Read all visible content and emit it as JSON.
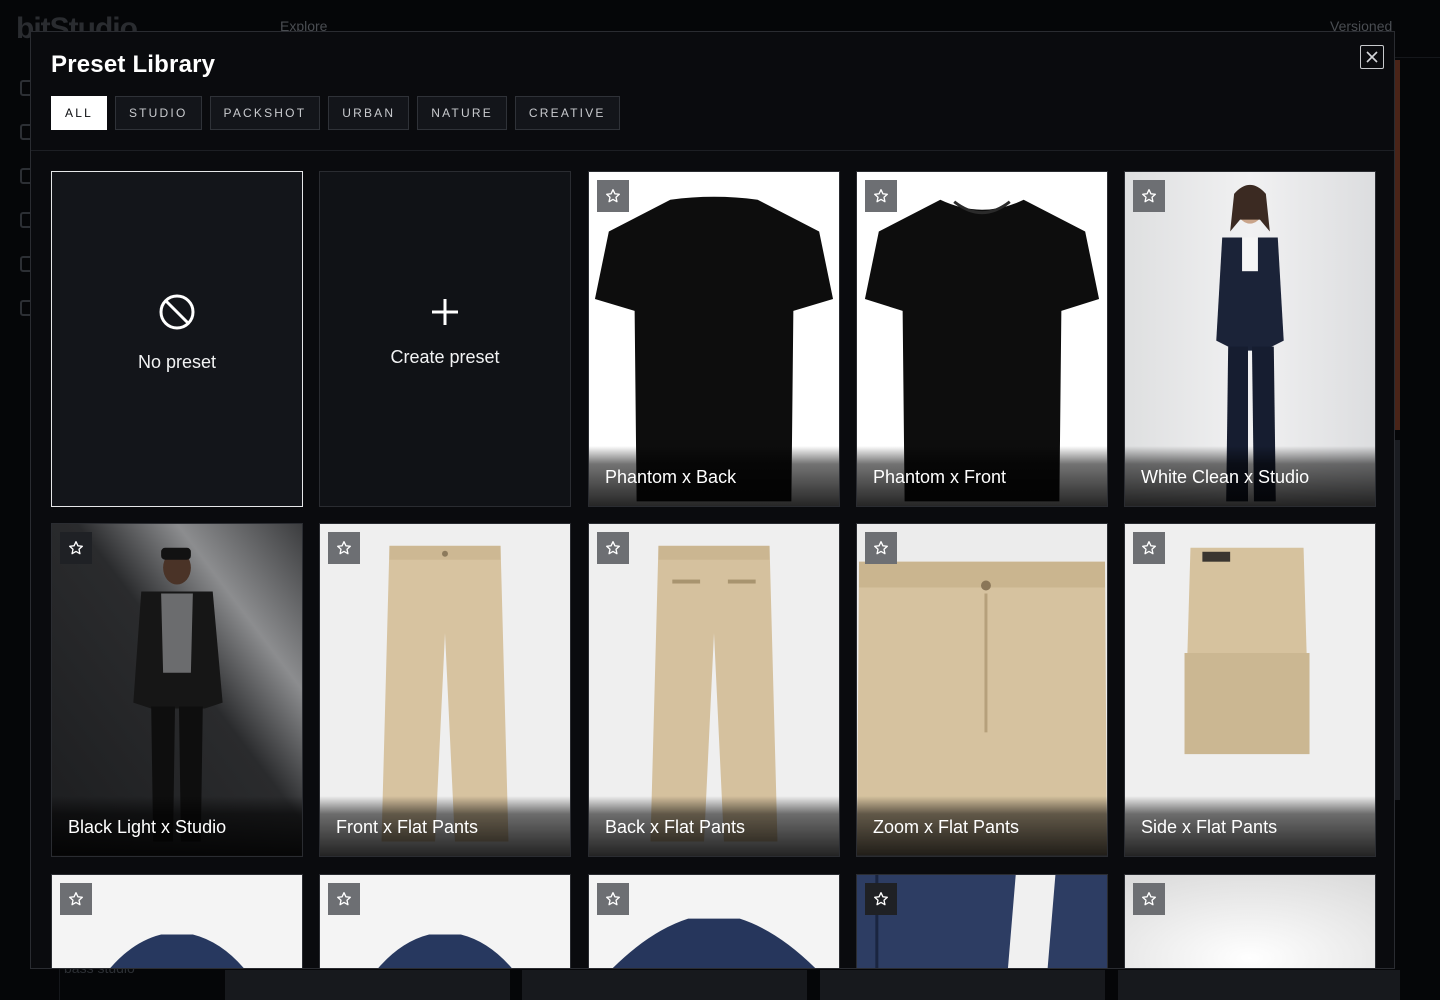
{
  "background": {
    "logo": "bitStudio",
    "topbar_items": [
      "Explore",
      "Versioned"
    ],
    "bottom_text": "bass studio"
  },
  "modal": {
    "title": "Preset Library",
    "close_icon": "close-icon",
    "filters": [
      {
        "label": "ALL",
        "active": true
      },
      {
        "label": "STUDIO",
        "active": false
      },
      {
        "label": "PACKSHOT",
        "active": false
      },
      {
        "label": "URBAN",
        "active": false
      },
      {
        "label": "NATURE",
        "active": false
      },
      {
        "label": "CREATIVE",
        "active": false
      }
    ],
    "no_preset": {
      "label": "No preset",
      "icon": "ban-icon",
      "selected": true
    },
    "create_preset": {
      "label": "Create preset",
      "icon": "plus-icon"
    },
    "presets": [
      {
        "label": "Phantom x Back",
        "image": "black-tshirt-back",
        "favorite": false
      },
      {
        "label": "Phantom x Front",
        "image": "black-tshirt-front",
        "favorite": false
      },
      {
        "label": "White Clean x Studio",
        "image": "woman-navy-suit",
        "favorite": false
      },
      {
        "label": "Black Light x Studio",
        "image": "man-leather-jacket",
        "favorite": false
      },
      {
        "label": "Front x Flat Pants",
        "image": "khaki-pants-front",
        "favorite": false
      },
      {
        "label": "Back x Flat Pants",
        "image": "khaki-pants-back",
        "favorite": false
      },
      {
        "label": "Zoom x Flat Pants",
        "image": "khaki-pants-zoom",
        "favorite": false
      },
      {
        "label": "Side x Flat Pants",
        "image": "khaki-pants-folded",
        "favorite": false
      },
      {
        "label": "",
        "image": "navy-jacket-collar",
        "favorite": false
      },
      {
        "label": "",
        "image": "navy-jacket-collar",
        "favorite": false
      },
      {
        "label": "",
        "image": "navy-jacket-collar-zoom",
        "favorite": false
      },
      {
        "label": "",
        "image": "navy-jacket-detail",
        "favorite": false
      },
      {
        "label": "",
        "image": "white-studio",
        "favorite": false
      }
    ]
  }
}
